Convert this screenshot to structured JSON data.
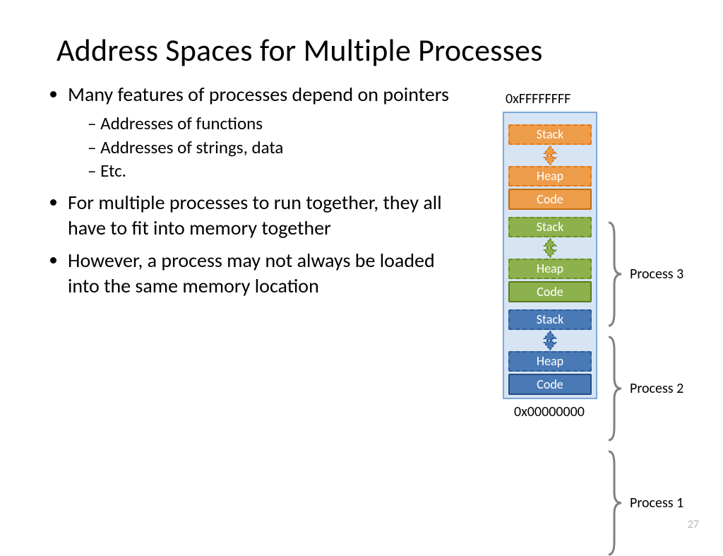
{
  "title": "Address Spaces for Multiple Processes",
  "bullets": {
    "b1": "Many features of processes depend on pointers",
    "b1a": "Addresses of functions",
    "b1b": "Addresses of strings, data",
    "b1c": "Etc.",
    "b2": "For multiple processes to run together, they all have to fit into memory together",
    "b3": "However, a process may not always be loaded into the same memory location"
  },
  "mem": {
    "top": "0xFFFFFFFF",
    "bottom": "0x00000000",
    "stack": "Stack",
    "heap": "Heap",
    "code": "Code"
  },
  "labels": {
    "p3": "Process 3",
    "p2": "Process 2",
    "p1": "Process 1"
  },
  "page": "27"
}
